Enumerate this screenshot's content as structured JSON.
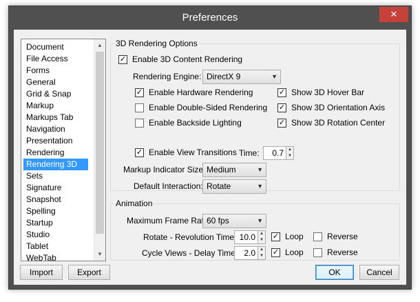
{
  "window": {
    "title": "Preferences",
    "close_glyph": "✕"
  },
  "categories": {
    "items": [
      "Document",
      "File Access",
      "Forms",
      "General",
      "Grid & Snap",
      "Markup",
      "Markups Tab",
      "Navigation",
      "Presentation",
      "Rendering",
      "Rendering 3D",
      "Sets",
      "Signature",
      "Snapshot",
      "Spelling",
      "Startup",
      "Studio",
      "Tablet",
      "WebTab"
    ],
    "selected": "Rendering 3D"
  },
  "rendering": {
    "group_label": "3D Rendering Options",
    "enable_3d": {
      "label": "Enable 3D Content Rendering",
      "checked": true
    },
    "engine": {
      "label": "Rendering Engine:",
      "value": "DirectX 9"
    },
    "hardware": {
      "label": "Enable Hardware Rendering",
      "checked": true
    },
    "double_sided": {
      "label": "Enable Double-Sided Rendering",
      "checked": false
    },
    "backside": {
      "label": "Enable Backside Lighting",
      "checked": false
    },
    "hover_bar": {
      "label": "Show 3D Hover Bar",
      "checked": true
    },
    "orientation_axis": {
      "label": "Show 3D Orientation Axis",
      "checked": true
    },
    "rotation_center": {
      "label": "Show 3D Rotation Center",
      "checked": true
    },
    "view_transitions": {
      "label": "Enable View Transitions",
      "checked": true
    },
    "time": {
      "label": "Time:",
      "value": "0.7"
    },
    "markup_indicator": {
      "label": "Markup Indicator Size:",
      "value": "Medium"
    },
    "default_interaction": {
      "label": "Default Interaction:",
      "value": "Rotate"
    }
  },
  "animation": {
    "group_label": "Animation",
    "max_frame_rate": {
      "label": "Maximum Frame Rate:",
      "value": "60 fps"
    },
    "revolution": {
      "label": "Rotate - Revolution Time:",
      "value": "10.0",
      "loop": "Loop",
      "loop_checked": true,
      "reverse": "Reverse",
      "reverse_checked": false
    },
    "delay": {
      "label": "Cycle Views - Delay Time:",
      "value": "2.0",
      "loop": "Loop",
      "loop_checked": true,
      "reverse": "Reverse",
      "reverse_checked": false
    }
  },
  "buttons": {
    "import": "Import",
    "export": "Export",
    "ok": "OK",
    "cancel": "Cancel"
  },
  "glyphs": {
    "check": "✓",
    "up": "▲",
    "down": "▼",
    "combo": "▼"
  }
}
